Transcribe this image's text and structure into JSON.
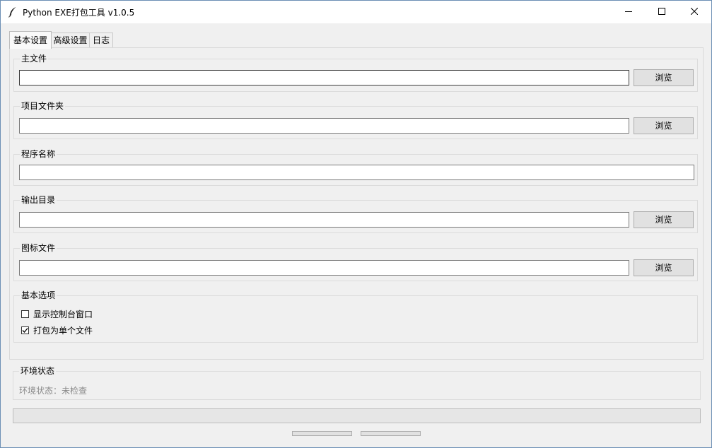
{
  "window": {
    "title": "Python EXE打包工具 v1.0.5",
    "icons": {
      "app": "feather-icon",
      "minimize": "minimize-icon",
      "maximize": "maximize-icon",
      "close": "close-icon"
    }
  },
  "tabs": [
    {
      "label": "基本设置",
      "active": true
    },
    {
      "label": "高级设置",
      "active": false
    },
    {
      "label": "日志",
      "active": false
    }
  ],
  "basic": {
    "main_file": {
      "label": "主文件",
      "value": "",
      "browse": "浏览"
    },
    "project_folder": {
      "label": "项目文件夹",
      "value": "",
      "browse": "浏览"
    },
    "program_name": {
      "label": "程序名称",
      "value": ""
    },
    "output_dir": {
      "label": "输出目录",
      "value": "",
      "browse": "浏览"
    },
    "icon_file": {
      "label": "图标文件",
      "value": "",
      "browse": "浏览"
    },
    "options": {
      "label": "基本选项",
      "items": [
        {
          "label": "显示控制台窗口",
          "checked": false
        },
        {
          "label": "打包为单个文件",
          "checked": true
        }
      ]
    }
  },
  "env": {
    "label": "环境状态",
    "status": "环境状态：未检查"
  },
  "progress": {
    "value": 0
  }
}
